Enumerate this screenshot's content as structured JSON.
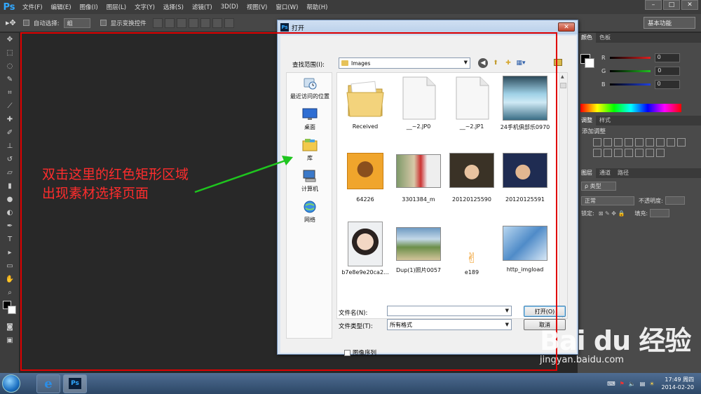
{
  "menubar": {
    "logo": "Ps",
    "items": [
      "文件(F)",
      "编辑(E)",
      "图像(I)",
      "图层(L)",
      "文字(Y)",
      "选择(S)",
      "滤镜(T)",
      "3D(D)",
      "视图(V)",
      "窗口(W)",
      "帮助(H)"
    ],
    "window_buttons": [
      "–",
      "□",
      "✕"
    ]
  },
  "optionsbar": {
    "auto_select_label": "自动选择:",
    "auto_select_value": "组",
    "show_transform_label": "显示变换控件",
    "workspace": "基本功能"
  },
  "panels": {
    "color_tabs": [
      "颜色",
      "色板"
    ],
    "channels": [
      {
        "label": "R",
        "value": "0",
        "color": "#e02020"
      },
      {
        "label": "G",
        "value": "0",
        "color": "#20c020"
      },
      {
        "label": "B",
        "value": "0",
        "color": "#2040e0"
      }
    ],
    "adjust_tabs": [
      "调整",
      "样式"
    ],
    "adjust_title": "添加调整",
    "layers_tabs": [
      "图层",
      "通道",
      "路径"
    ],
    "layer_kind": "ρ 类型",
    "blend_mode": "正常",
    "opacity_label": "不透明度:",
    "lock_label": "锁定:",
    "fill_label": "填充:"
  },
  "dialog": {
    "title": "打开",
    "close": "✕",
    "look_in_label": "查找范围(I):",
    "look_in_value": "Images",
    "places": [
      "最近访问的位置",
      "桌面",
      "库",
      "计算机",
      "网络"
    ],
    "files": [
      "Received",
      "__~2.JP0",
      "__~2.JP1",
      "24手机俱部乐0970",
      "64226",
      "3301384_m",
      "20120125590",
      "20120125591",
      "b7e8e9e20ca2...",
      "Dup(1)照片0057",
      "e189",
      "http_imgload"
    ],
    "filename_label": "文件名(N):",
    "filename_value": "",
    "filetype_label": "文件类型(T):",
    "filetype_value": "所有格式",
    "open_button": "打开(O)",
    "cancel_button": "取消",
    "sequence_label": "图像序列"
  },
  "annotation": {
    "line1": "双击这里的红色矩形区域",
    "line2": "出现素材选择页面",
    "color": "#ff2d2d"
  },
  "taskbar": {
    "time": "17:49 周四",
    "date": "2014-02-20"
  },
  "watermark": {
    "main": "Bai du 经验",
    "sub": "jingyan.baidu.com"
  }
}
